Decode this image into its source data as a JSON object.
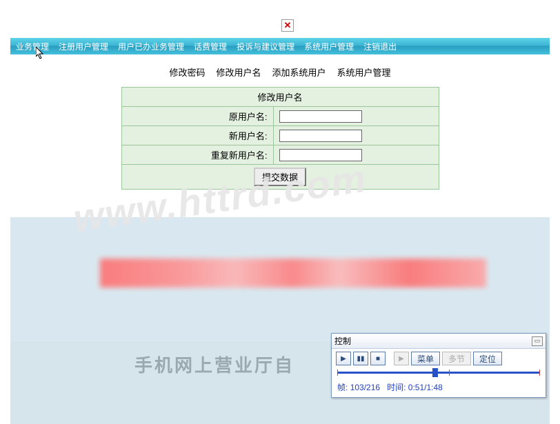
{
  "nav": {
    "items": [
      "业务管理",
      "注册用户管理",
      "用户已办业务管理",
      "话费管理",
      "投诉与建议管理",
      "系统用户管理",
      "注销退出"
    ]
  },
  "subnav": {
    "items": [
      "修改密码",
      "修改用户名",
      "添加系统用户",
      "系统用户管理"
    ]
  },
  "form": {
    "title": "修改用户名",
    "rows": [
      {
        "label": "原用户名:"
      },
      {
        "label": "新用户名:"
      },
      {
        "label": "重复新用户名:"
      }
    ],
    "submit": "提交数据"
  },
  "watermark": "www.httrd.com",
  "footer": {
    "text": "手机网上营业厅自"
  },
  "control": {
    "title": "控制",
    "menu": "菜单",
    "multi": "多节",
    "locate": "定位",
    "status_frame_label": "帧:",
    "status_frame_value": "103/216",
    "status_time_label": "时间:",
    "status_time_value": "0:51/1:48"
  }
}
